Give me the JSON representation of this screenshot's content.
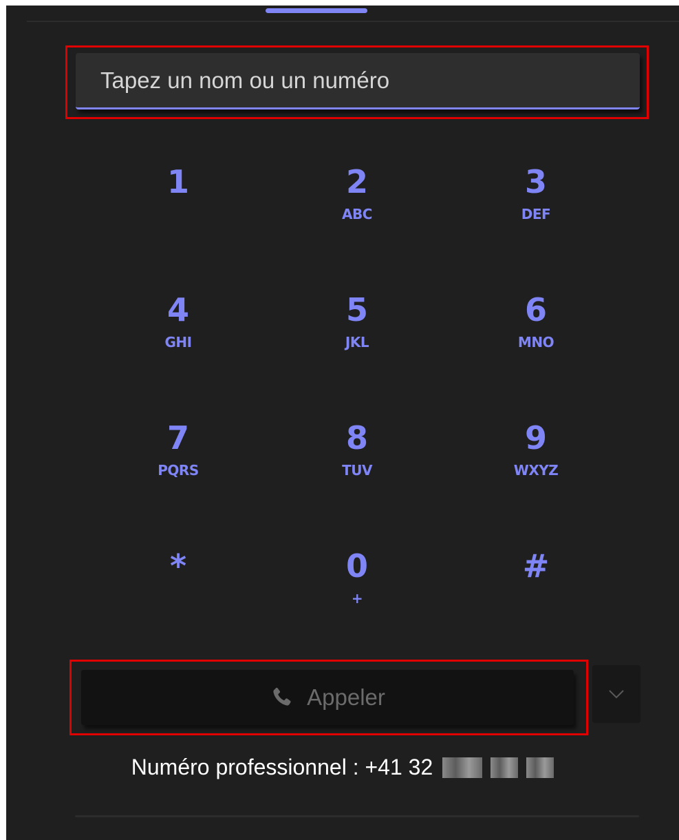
{
  "search": {
    "placeholder": "Tapez un nom ou un numéro",
    "value": ""
  },
  "keypad": [
    {
      "digit": "1",
      "letters": ""
    },
    {
      "digit": "2",
      "letters": "ABC"
    },
    {
      "digit": "3",
      "letters": "DEF"
    },
    {
      "digit": "4",
      "letters": "GHI"
    },
    {
      "digit": "5",
      "letters": "JKL"
    },
    {
      "digit": "6",
      "letters": "MNO"
    },
    {
      "digit": "7",
      "letters": "PQRS"
    },
    {
      "digit": "8",
      "letters": "TUV"
    },
    {
      "digit": "9",
      "letters": "WXYZ"
    },
    {
      "digit": "*",
      "letters": ""
    },
    {
      "digit": "0",
      "letters": "+"
    },
    {
      "digit": "#",
      "letters": ""
    }
  ],
  "call": {
    "label": "Appeler",
    "icon": "phone-icon",
    "dropdown_icon": "chevron-down-icon"
  },
  "work_number": {
    "text": "Numéro professionnel : +41 32"
  },
  "colors": {
    "accent": "#7f85f5",
    "background": "#1f1f1f",
    "highlight": "#e00000"
  }
}
